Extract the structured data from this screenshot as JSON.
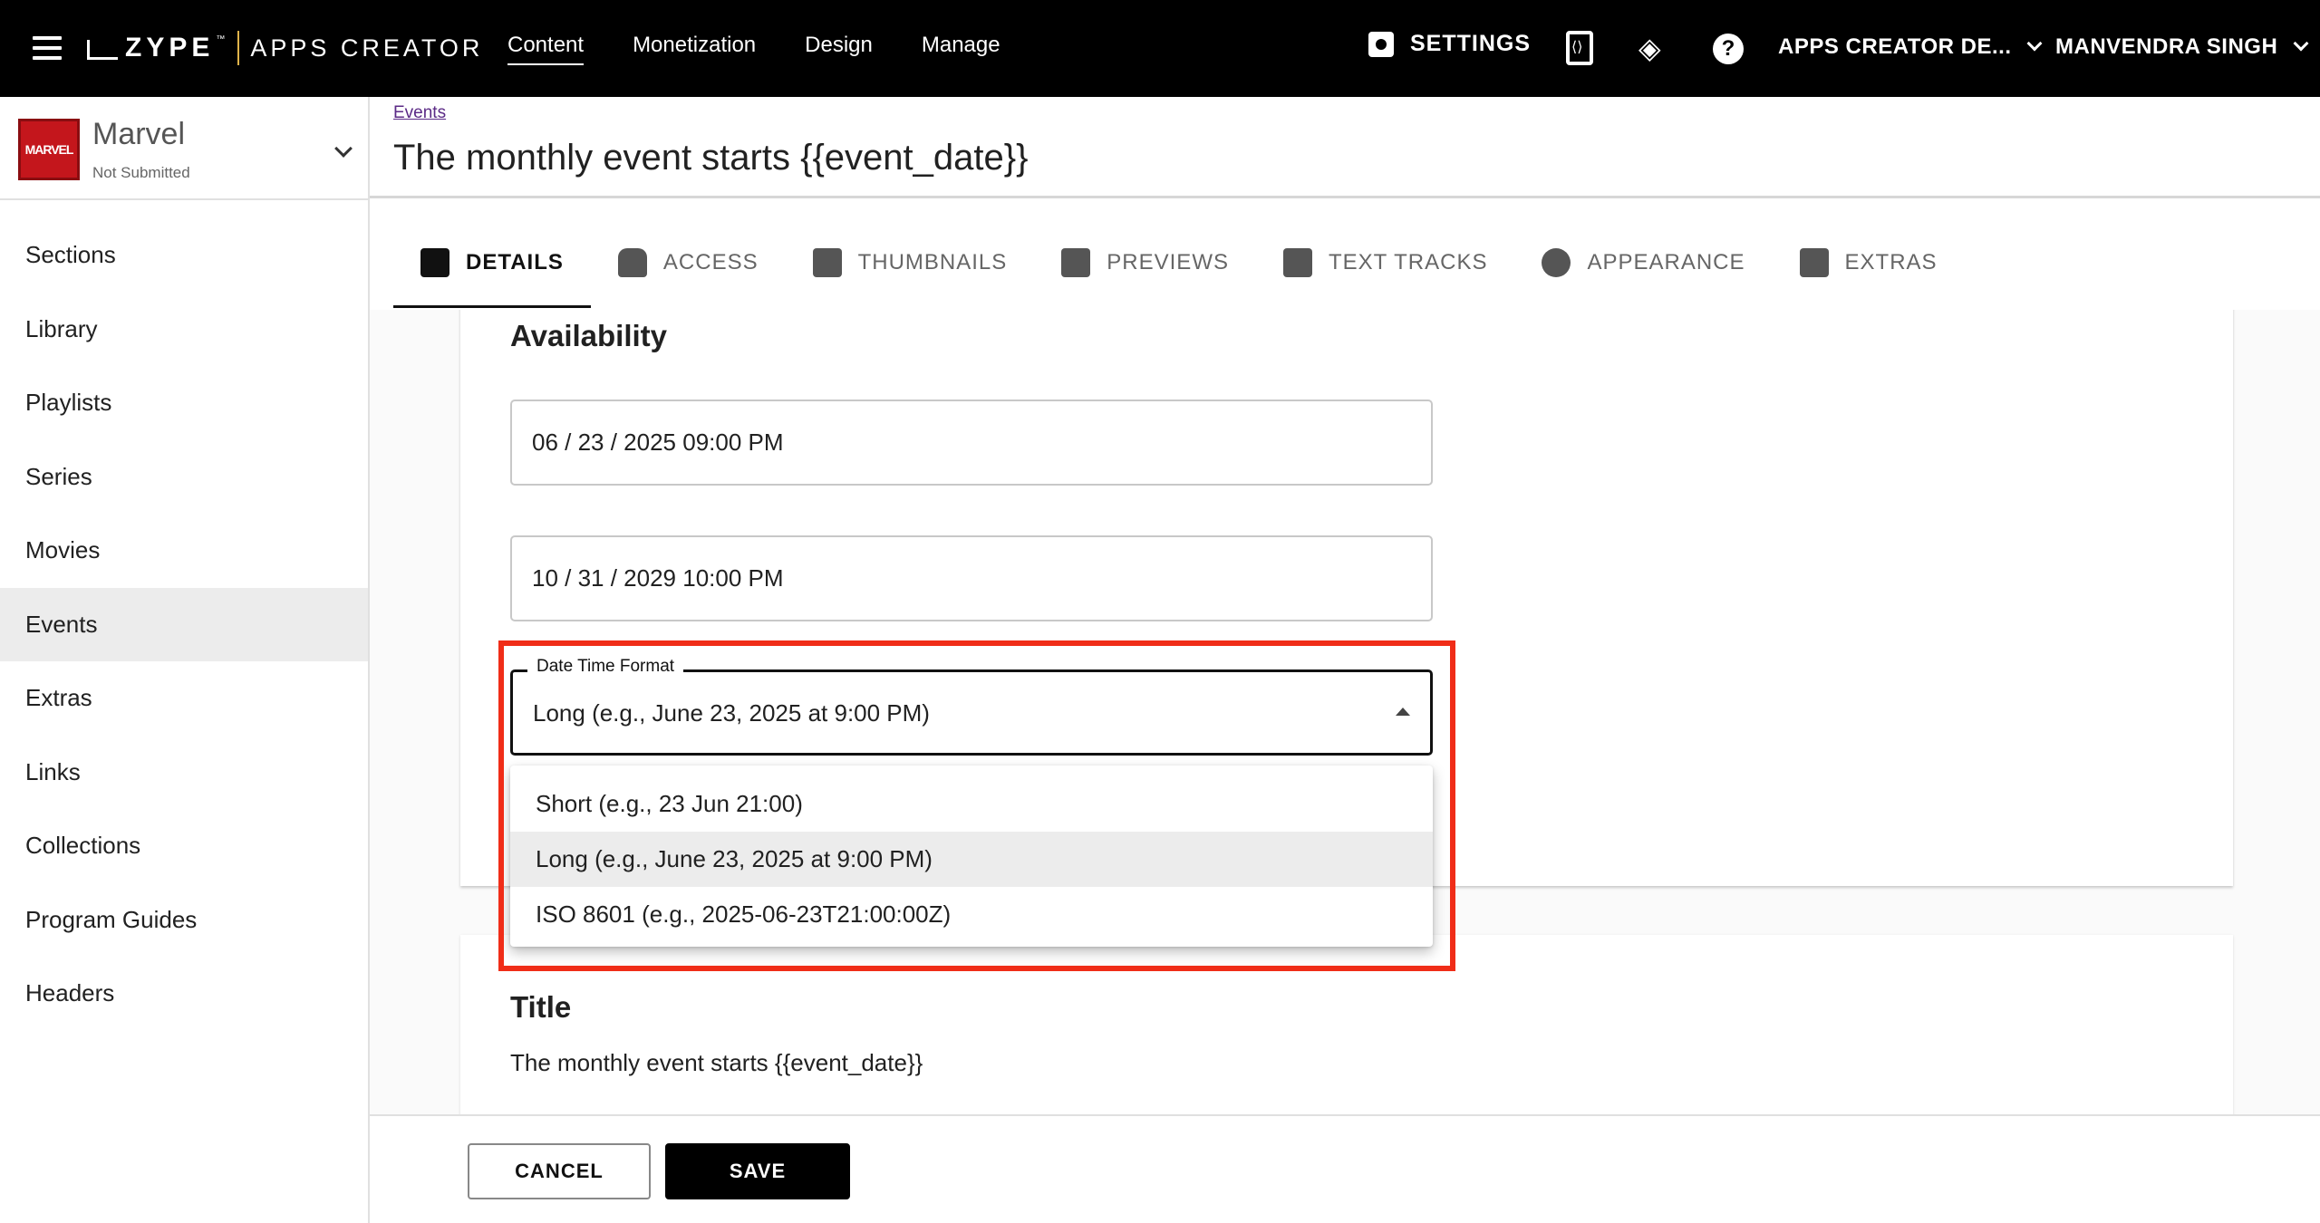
{
  "topbar": {
    "logo_text": "ZYPE",
    "logo_product": "APPS CREATOR",
    "nav": [
      {
        "label": "Content",
        "active": true
      },
      {
        "label": "Monetization"
      },
      {
        "label": "Design"
      },
      {
        "label": "Manage"
      }
    ],
    "settings_label": "SETTINGS",
    "account_label": "APPS CREATOR DE...",
    "user_label": "MANVENDRA SINGH"
  },
  "sidebar": {
    "app_logo_text": "MARVEL",
    "app_name": "Marvel",
    "app_status": "Not Submitted",
    "items": [
      {
        "label": "Sections"
      },
      {
        "label": "Library"
      },
      {
        "label": "Playlists"
      },
      {
        "label": "Series"
      },
      {
        "label": "Movies"
      },
      {
        "label": "Events",
        "active": true
      },
      {
        "label": "Extras"
      },
      {
        "label": "Links"
      },
      {
        "label": "Collections"
      },
      {
        "label": "Program Guides"
      },
      {
        "label": "Headers"
      }
    ]
  },
  "header": {
    "breadcrumb": "Events",
    "title": "The monthly event starts {{event_date}}"
  },
  "tabs": [
    {
      "label": "DETAILS",
      "icon": "document-icon",
      "active": true
    },
    {
      "label": "ACCESS",
      "icon": "lock-icon"
    },
    {
      "label": "THUMBNAILS",
      "icon": "image-icon"
    },
    {
      "label": "PREVIEWS",
      "icon": "preview-icon"
    },
    {
      "label": "TEXT TRACKS",
      "icon": "subtitles-icon"
    },
    {
      "label": "APPEARANCE",
      "icon": "palette-icon"
    },
    {
      "label": "EXTRAS",
      "icon": "add-box-icon"
    }
  ],
  "availability": {
    "title": "Availability",
    "start_value": "06 / 23 / 2025 09:00 PM",
    "end_value": "10 / 31 / 2029 10:00 PM",
    "format_label": "Date Time Format",
    "format_value": "Long (e.g., June 23, 2025 at 9:00 PM)",
    "format_options": [
      {
        "label": "Short (e.g., 23 Jun 21:00)"
      },
      {
        "label": "Long (e.g., June 23, 2025 at 9:00 PM)",
        "selected": true
      },
      {
        "label": "ISO 8601 (e.g., 2025-06-23T21:00:00Z)"
      }
    ]
  },
  "title_section": {
    "title": "Title",
    "value": "The monthly event starts {{event_date}}"
  },
  "footer": {
    "cancel_label": "CANCEL",
    "save_label": "SAVE"
  },
  "colors": {
    "topbar_bg": "#000000",
    "highlight": "#f02d18",
    "brand_red": "#c4161c",
    "logo_divider": "#e0b34a"
  }
}
